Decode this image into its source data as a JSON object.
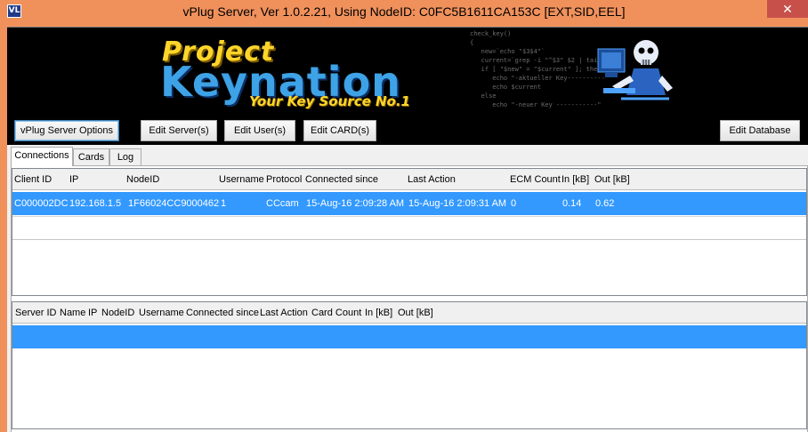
{
  "window": {
    "title": "vPlug Server,  Ver 1.0.2.21, Using NodeID: C0FC5B1611CA153C [EXT,SID,EEL]",
    "icon_text": "VL",
    "close_glyph": "✕"
  },
  "banner": {
    "logo_line1": "Project",
    "logo_line2": "Keynation",
    "logo_line3": "Your Key Source No.1",
    "code_text": "check_key()\n{\n   new=`echo \"$3$4\"`\n   current=`grep -i \"^$3\" $2 | tail -1`\n   if [ \"$new\" = \"$current\" ]; then\n      echo \"-aktueller Key----------\"\n      echo $current\n   else\n      echo \"-neuer Key -----------\""
  },
  "toolbar": {
    "server_options": "vPlug Server Options",
    "edit_servers": "Edit Server(s)",
    "edit_users": "Edit User(s)",
    "edit_cards": "Edit CARD(s)",
    "edit_database": "Edit Database"
  },
  "tabs": {
    "connections": "Connections",
    "cards": "Cards",
    "log": "Log"
  },
  "connections_grid": {
    "columns": {
      "client_id": "Client ID",
      "ip": "IP",
      "node_id": "NodeID",
      "username": "Username",
      "protocol": "Protocol",
      "connected_since": "Connected since",
      "last_action": "Last Action",
      "ecm_count": "ECM Count",
      "in_kb": "In [kB]",
      "out_kb": "Out [kB]"
    },
    "rows": [
      {
        "client_id": "C000002DC",
        "ip": "192.168.1.5",
        "node_id": "1F66024CC9000462",
        "username": "1",
        "protocol": "CCcam",
        "connected_since": "15-Aug-16 2:09:28 AM",
        "last_action": "15-Aug-16 2:09:31 AM",
        "ecm_count": "0",
        "in_kb": "0.14",
        "out_kb": "0.62"
      }
    ]
  },
  "servers_grid": {
    "columns": {
      "server_id": "Server ID",
      "name": "Name",
      "ip": "IP",
      "node_id": "NodeID",
      "username": "Username",
      "connected_since": "Connected since",
      "last_action": "Last Action",
      "card_count": "Card Count",
      "in_kb": "In [kB]",
      "out_kb": "Out [kB]"
    }
  },
  "colors": {
    "frame": "#f0915c",
    "selection": "#3399ff",
    "banner_bg": "#000000"
  }
}
